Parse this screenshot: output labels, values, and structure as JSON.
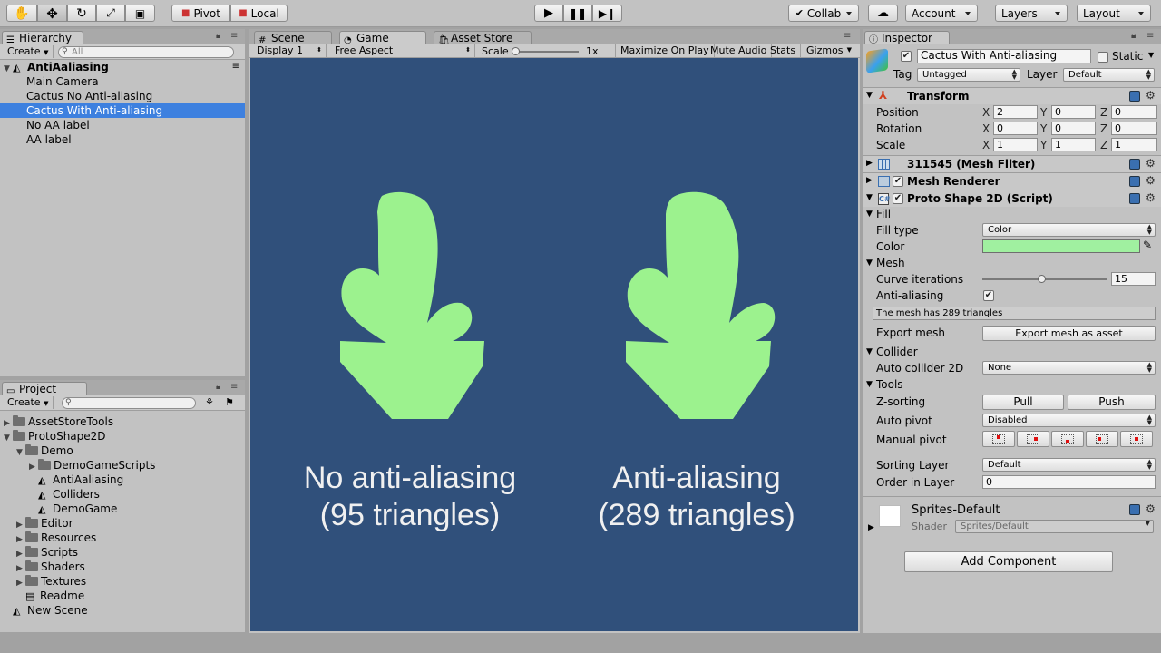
{
  "toolbar": {
    "pivot_label": "Pivot",
    "local_label": "Local",
    "collab_label": "Collab",
    "account_label": "Account",
    "layers_label": "Layers",
    "layout_label": "Layout"
  },
  "hierarchy": {
    "tab_label": "Hierarchy",
    "create_label": "Create",
    "search_placeholder": "All",
    "scene_name": "AntiAaliasing",
    "items": [
      {
        "label": "Main Camera"
      },
      {
        "label": "Cactus No Anti-aliasing"
      },
      {
        "label": "Cactus With Anti-aliasing",
        "selected": true
      },
      {
        "label": "No AA label"
      },
      {
        "label": "AA label"
      }
    ]
  },
  "project": {
    "tab_label": "Project",
    "create_label": "Create",
    "items": [
      {
        "label": "AssetStoreTools",
        "type": "folder",
        "depth": 0,
        "fold": "▶"
      },
      {
        "label": "ProtoShape2D",
        "type": "folder",
        "depth": 0,
        "fold": "▼"
      },
      {
        "label": "Demo",
        "type": "folder",
        "depth": 1,
        "fold": "▼"
      },
      {
        "label": "DemoGameScripts",
        "type": "folder",
        "depth": 2,
        "fold": "▶"
      },
      {
        "label": "AntiAaliasing",
        "type": "scene",
        "depth": 2,
        "fold": ""
      },
      {
        "label": "Colliders",
        "type": "scene",
        "depth": 2,
        "fold": ""
      },
      {
        "label": "DemoGame",
        "type": "scene",
        "depth": 2,
        "fold": ""
      },
      {
        "label": "Editor",
        "type": "folder",
        "depth": 1,
        "fold": "▶"
      },
      {
        "label": "Resources",
        "type": "folder",
        "depth": 1,
        "fold": "▶"
      },
      {
        "label": "Scripts",
        "type": "folder",
        "depth": 1,
        "fold": "▶"
      },
      {
        "label": "Shaders",
        "type": "folder",
        "depth": 1,
        "fold": "▶"
      },
      {
        "label": "Textures",
        "type": "folder",
        "depth": 1,
        "fold": "▶"
      },
      {
        "label": "Readme",
        "type": "doc",
        "depth": 1,
        "fold": ""
      },
      {
        "label": "New Scene",
        "type": "scene",
        "depth": 0,
        "fold": ""
      }
    ]
  },
  "game": {
    "tabs": {
      "scene": "Scene",
      "game": "Game",
      "asset_store": "Asset Store"
    },
    "display_label": "Display 1",
    "aspect_label": "Free Aspect",
    "scale_label": "Scale",
    "scale_value": "1x",
    "maximize_label": "Maximize On Play",
    "mute_label": "Mute Audio",
    "stats_label": "Stats",
    "gizmos_label": "Gizmos",
    "cactus_color": "#9cf28e",
    "background_color": "#30507b",
    "label_left": "No anti-aliasing\n(95 triangles)",
    "label_right": "Anti-aliasing\n(289 triangles)"
  },
  "inspector": {
    "tab_label": "Inspector",
    "object_name": "Cactus With Anti-aliasing",
    "static_label": "Static",
    "tag_label": "Tag",
    "tag_value": "Untagged",
    "layer_label": "Layer",
    "layer_value": "Default",
    "transform": {
      "title": "Transform",
      "position_label": "Position",
      "rotation_label": "Rotation",
      "scale_label": "Scale",
      "x_label": "X",
      "y_label": "Y",
      "z_label": "Z",
      "position": {
        "x": "2",
        "y": "0",
        "z": "0"
      },
      "rotation": {
        "x": "0",
        "y": "0",
        "z": "0"
      },
      "scale": {
        "x": "1",
        "y": "1",
        "z": "1"
      }
    },
    "mesh_filter_title": "311545 (Mesh Filter)",
    "mesh_renderer_title": "Mesh Renderer",
    "proto_shape": {
      "title": "Proto Shape 2D (Script)",
      "fill_section": "Fill",
      "fill_type_label": "Fill type",
      "fill_type_value": "Color",
      "color_label": "Color",
      "color_value": "#a0f0a0",
      "mesh_section": "Mesh",
      "curve_iterations_label": "Curve iterations",
      "curve_iterations_value": "15",
      "anti_aliasing_label": "Anti-aliasing",
      "anti_aliasing_checked": true,
      "triangle_info": "The mesh has 289 triangles",
      "export_mesh_label": "Export mesh",
      "export_mesh_button": "Export mesh as asset",
      "collider_section": "Collider",
      "auto_collider_label": "Auto collider 2D",
      "auto_collider_value": "None",
      "tools_section": "Tools",
      "z_sorting_label": "Z-sorting",
      "pull_label": "Pull",
      "push_label": "Push",
      "auto_pivot_label": "Auto pivot",
      "auto_pivot_value": "Disabled",
      "manual_pivot_label": "Manual pivot",
      "sorting_layer_label": "Sorting Layer",
      "sorting_layer_value": "Default",
      "order_in_layer_label": "Order in Layer",
      "order_in_layer_value": "0"
    },
    "material": {
      "name": "Sprites-Default",
      "shader_label": "Shader",
      "shader_value": "Sprites/Default"
    },
    "add_component_label": "Add Component"
  }
}
